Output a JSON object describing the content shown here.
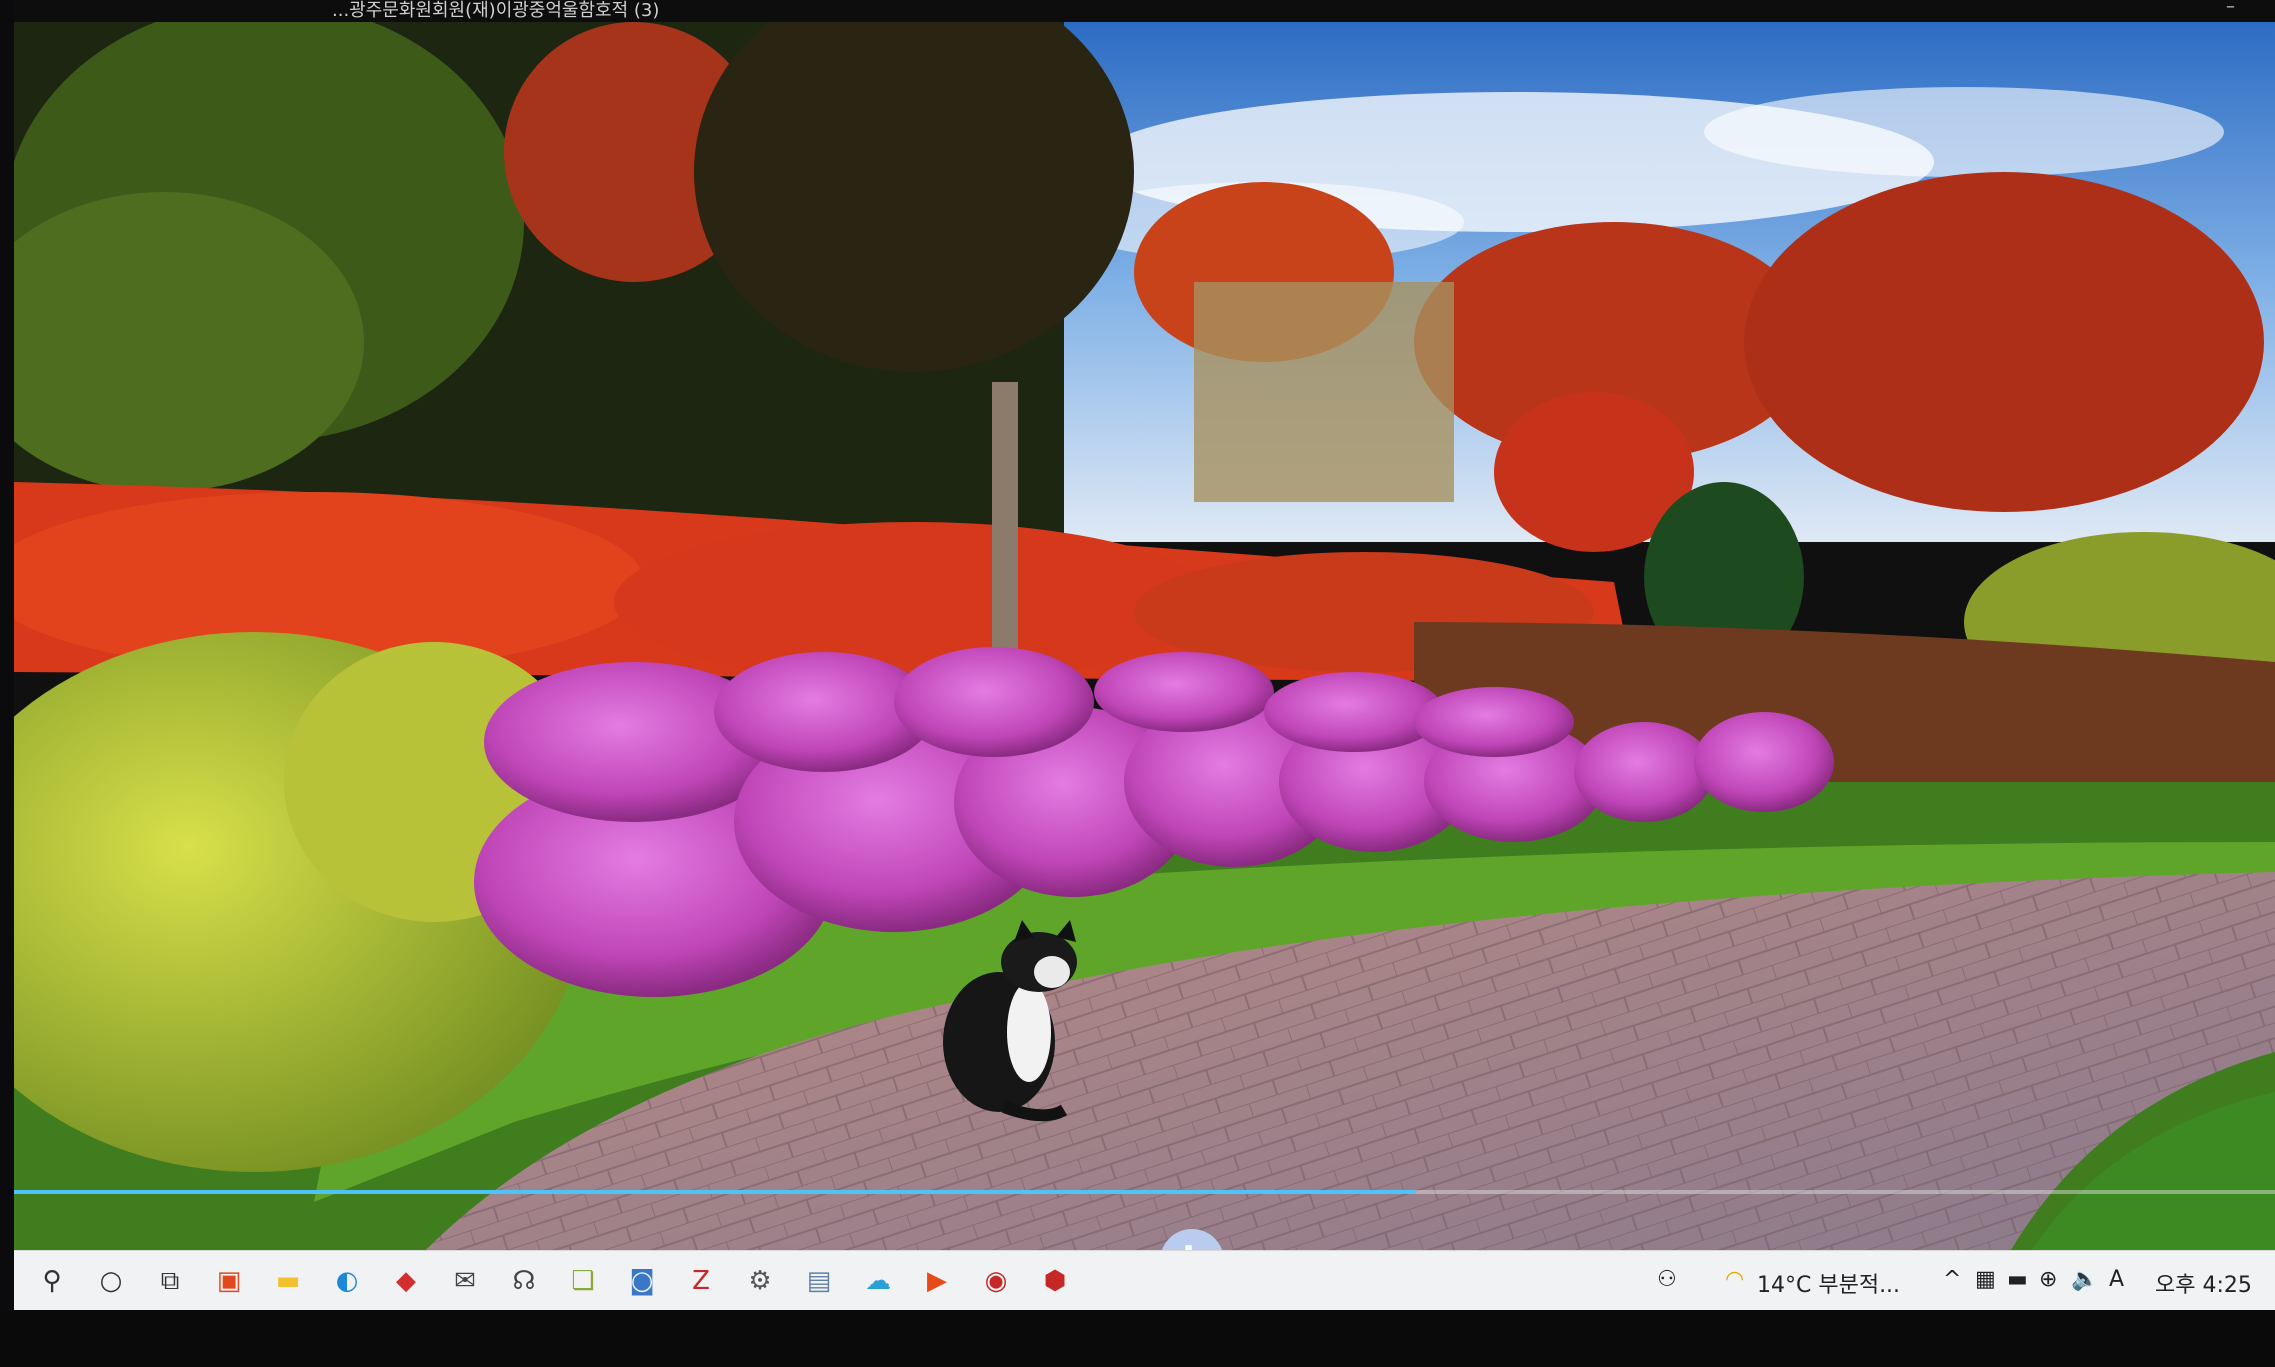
{
  "window": {
    "title": "...광주문화원회원(재)이광중억울함호적 (3)",
    "minimize_glyph": "–"
  },
  "video": {
    "scene": "garden-with-cat",
    "progress_fraction": 0.62,
    "play_button_glyph": "⏸"
  },
  "taskbar": {
    "apps": [
      {
        "name": "search-icon",
        "glyph": "⚲",
        "color": "#333333"
      },
      {
        "name": "cortana-icon",
        "glyph": "○",
        "color": "#333333"
      },
      {
        "name": "task-view-icon",
        "glyph": "⧉",
        "color": "#333333"
      },
      {
        "name": "office-icon",
        "glyph": "▣",
        "color": "#e2481f"
      },
      {
        "name": "file-explorer-icon",
        "glyph": "▬",
        "color": "#f2c12e"
      },
      {
        "name": "edge-icon",
        "glyph": "◐",
        "color": "#1e88d8"
      },
      {
        "name": "shield-app-icon",
        "glyph": "◆",
        "color": "#d32f2f"
      },
      {
        "name": "mail-icon",
        "glyph": "✉",
        "color": "#444444"
      },
      {
        "name": "remote-help-icon",
        "glyph": "☊",
        "color": "#444444"
      },
      {
        "name": "photos-app-icon",
        "glyph": "❏",
        "color": "#8aa83b"
      },
      {
        "name": "network-app-icon",
        "glyph": "◙",
        "color": "#3a78c7"
      },
      {
        "name": "filezilla-icon",
        "glyph": "Z",
        "color": "#c62828"
      },
      {
        "name": "settings-app-icon",
        "glyph": "⚙",
        "color": "#555555"
      },
      {
        "name": "screen-app-icon",
        "glyph": "▤",
        "color": "#5f7fa7"
      },
      {
        "name": "cloud-app-icon",
        "glyph": "☁",
        "color": "#2b9fd8"
      },
      {
        "name": "media-player-icon",
        "glyph": "▶",
        "color": "#e64a19"
      },
      {
        "name": "acrobat-icon",
        "glyph": "◉",
        "color": "#c62828"
      },
      {
        "name": "security-app-icon",
        "glyph": "⬢",
        "color": "#c62828"
      }
    ],
    "tray": {
      "people_glyph": "⚇",
      "weather": "14°C 부분적...",
      "chevron_glyph": "^",
      "network_glyph": "⊕",
      "volume_glyph": "🔈",
      "ime_label": "A",
      "clock": "오후 4:25"
    }
  }
}
